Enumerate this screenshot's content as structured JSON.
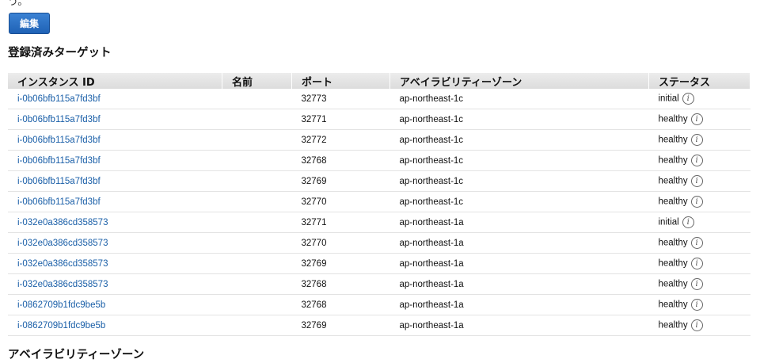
{
  "top_fragment": "う。",
  "edit_button": "編集",
  "section_title": "登録済みターゲット",
  "columns": [
    "インスタンス ID",
    "名前",
    "ポート",
    "アベイラビリティーゾーン",
    "ステータス"
  ],
  "rows": [
    {
      "instance": "i-0b06bfb115a7fd3bf",
      "name": "",
      "port": "32773",
      "zone": "ap-northeast-1c",
      "status": "initial"
    },
    {
      "instance": "i-0b06bfb115a7fd3bf",
      "name": "",
      "port": "32771",
      "zone": "ap-northeast-1c",
      "status": "healthy"
    },
    {
      "instance": "i-0b06bfb115a7fd3bf",
      "name": "",
      "port": "32772",
      "zone": "ap-northeast-1c",
      "status": "healthy"
    },
    {
      "instance": "i-0b06bfb115a7fd3bf",
      "name": "",
      "port": "32768",
      "zone": "ap-northeast-1c",
      "status": "healthy"
    },
    {
      "instance": "i-0b06bfb115a7fd3bf",
      "name": "",
      "port": "32769",
      "zone": "ap-northeast-1c",
      "status": "healthy"
    },
    {
      "instance": "i-0b06bfb115a7fd3bf",
      "name": "",
      "port": "32770",
      "zone": "ap-northeast-1c",
      "status": "healthy"
    },
    {
      "instance": "i-032e0a386cd358573",
      "name": "",
      "port": "32771",
      "zone": "ap-northeast-1a",
      "status": "initial"
    },
    {
      "instance": "i-032e0a386cd358573",
      "name": "",
      "port": "32770",
      "zone": "ap-northeast-1a",
      "status": "healthy"
    },
    {
      "instance": "i-032e0a386cd358573",
      "name": "",
      "port": "32769",
      "zone": "ap-northeast-1a",
      "status": "healthy"
    },
    {
      "instance": "i-032e0a386cd358573",
      "name": "",
      "port": "32768",
      "zone": "ap-northeast-1a",
      "status": "healthy"
    },
    {
      "instance": "i-0862709b1fdc9be5b",
      "name": "",
      "port": "32768",
      "zone": "ap-northeast-1a",
      "status": "healthy"
    },
    {
      "instance": "i-0862709b1fdc9be5b",
      "name": "",
      "port": "32769",
      "zone": "ap-northeast-1a",
      "status": "healthy"
    }
  ],
  "info_icon": {
    "name": "info-icon",
    "glyph": "i"
  },
  "section_title_2": "アベイラビリティーゾーン"
}
